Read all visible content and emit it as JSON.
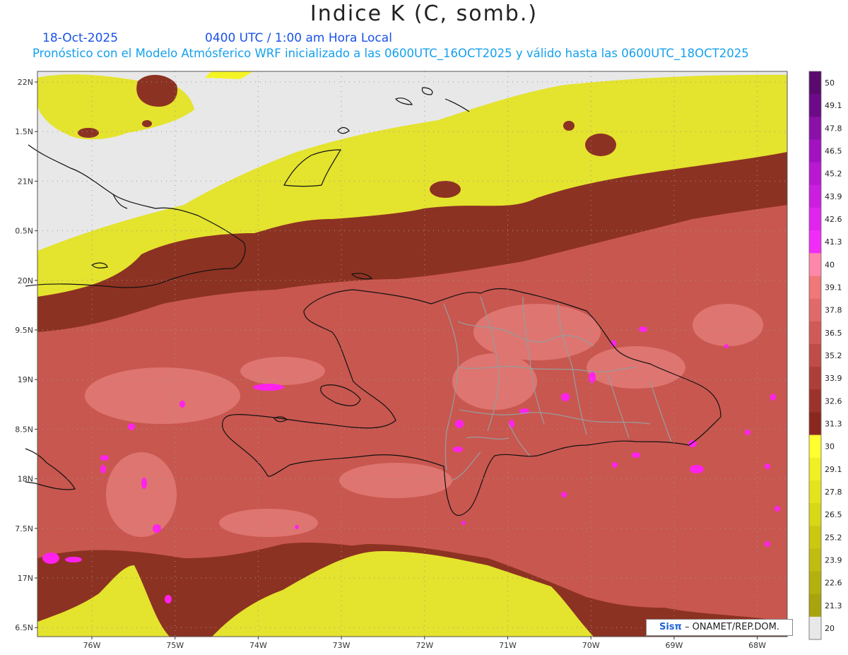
{
  "header": {
    "title": "Indice K (C, somb.)",
    "date": "18-Oct-2025",
    "time": "0400 UTC / 1:00 am Hora Local",
    "forecast": "Pronóstico con el Modelo Atmósferico WRF inicializado a las 0600UTC_16OCT2025 y válido hasta las  0600UTC_18OCT2025"
  },
  "map": {
    "lat_labels": [
      "22N",
      "1.5N",
      "21N",
      "0.5N",
      "20N",
      "9.5N",
      "19N",
      "8.5N",
      "18N",
      "7.5N",
      "17N",
      "6.5N"
    ],
    "lon_labels": [
      "76W",
      "75W",
      "74W",
      "73W",
      "72W",
      "71W",
      "70W",
      "69W",
      "68W"
    ],
    "lat_range": [
      16.4,
      22.15
    ],
    "lon_range": [
      -76.65,
      -67.6
    ]
  },
  "colorbar": {
    "labels": [
      "50",
      "49.1",
      "47.8",
      "46.5",
      "45.2",
      "43.9",
      "42.6",
      "41.3",
      "40",
      "39.1",
      "37.8",
      "36.5",
      "35.2",
      "33.9",
      "32.6",
      "31.3",
      "30",
      "29.1",
      "27.8",
      "26.5",
      "25.2",
      "23.9",
      "22.6",
      "21.3",
      "20"
    ],
    "colors": [
      "#5a0a6e",
      "#6c0a88",
      "#8a10a8",
      "#a212c0",
      "#b818d2",
      "#cc1ee0",
      "#e024ee",
      "#f22cf8",
      "#ff88aa",
      "#f07878",
      "#e06a6a",
      "#d05a58",
      "#c04c48",
      "#ae3e38",
      "#9c322c",
      "#8a2820",
      "#ffff30",
      "#f0f024",
      "#e4e41c",
      "#d8d816",
      "#ccc812",
      "#c0bc10",
      "#b4b00e",
      "#a8a40c",
      "#e8e8e8"
    ]
  },
  "credit": {
    "logo": "Sisπ",
    "text": "– ONAMET/REP.DOM."
  },
  "palette": {
    "nodata": "#e8e8e8",
    "yellow": "#e4e32e",
    "yellow_bright": "#f4f424",
    "brown": "#8c3222",
    "salmon": "#c8574f",
    "pink": "#de7570",
    "magenta": "#ff22ee",
    "coast": "#111111",
    "provinces": "#9a9a9a"
  }
}
